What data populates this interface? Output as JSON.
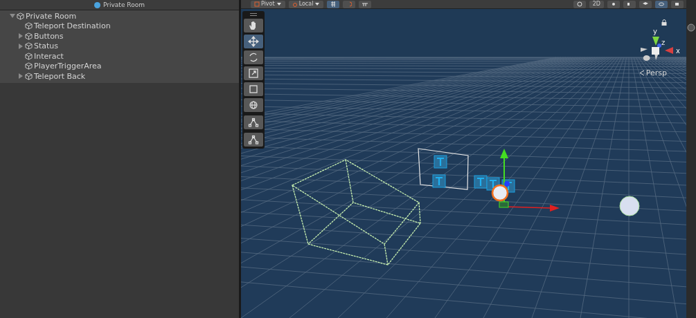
{
  "hierarchy": {
    "header_title": "Private Room",
    "tree": [
      {
        "label": "Private Room",
        "expanded": true,
        "children": [
          {
            "label": "Teleport Destination"
          },
          {
            "label": "Buttons",
            "expanded": false
          },
          {
            "label": "Status",
            "expanded": false
          },
          {
            "label": "Interact"
          },
          {
            "label": "PlayerTriggerArea"
          },
          {
            "label": "Teleport Back",
            "expanded": false
          }
        ]
      }
    ]
  },
  "scene_toolbar": {
    "pivot": "Pivot",
    "space": "Local",
    "grid_snap_selected": true,
    "mode_2d": "2D",
    "gizmos_selected": true
  },
  "tools": [
    {
      "kind": "hand",
      "selected": false
    },
    {
      "kind": "move",
      "selected": true
    },
    {
      "kind": "rotate",
      "selected": false
    },
    {
      "kind": "scale",
      "selected": false
    },
    {
      "kind": "rect",
      "selected": false
    },
    {
      "kind": "transform",
      "selected": false
    },
    {
      "kind": "custom",
      "selected": false
    },
    {
      "kind": "custom",
      "selected": false
    }
  ],
  "orientation_gizmo": {
    "y": "y",
    "z": "z",
    "x": "x",
    "projection": "Persp"
  }
}
